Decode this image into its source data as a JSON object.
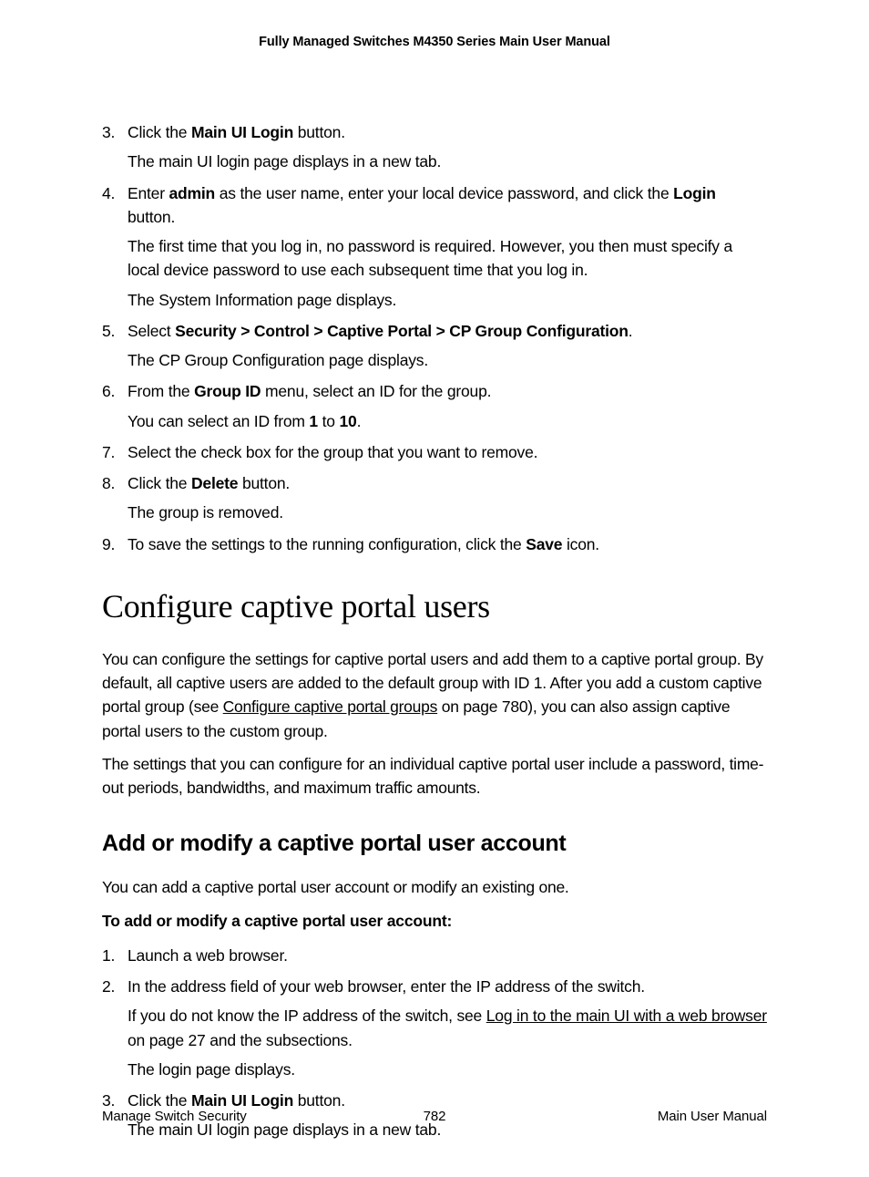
{
  "header": "Fully Managed Switches M4350 Series Main User Manual",
  "steps1": {
    "s3": {
      "a": "Click the ",
      "b": "Main UI Login",
      "c": " button.",
      "p1": "The main UI login page displays in a new tab."
    },
    "s4": {
      "a": "Enter ",
      "b": "admin",
      "c": " as the user name, enter your local device password, and click the ",
      "d": "Login",
      "e": " button.",
      "p1": "The first time that you log in, no password is required. However, you then must specify a local device password to use each subsequent time that you log in.",
      "p2": "The System Information page displays."
    },
    "s5": {
      "a": "Select ",
      "b": "Security > Control > Captive Portal > CP Group Configuration",
      "c": ".",
      "p1": "The CP Group Configuration page displays."
    },
    "s6": {
      "a": "From the ",
      "b": "Group ID",
      "c": " menu, select an ID for the group.",
      "p1a": "You can select an ID from ",
      "p1b": "1",
      "p1c": " to ",
      "p1d": "10",
      "p1e": "."
    },
    "s7": {
      "a": "Select the check box for the group that you want to remove."
    },
    "s8": {
      "a": "Click the ",
      "b": "Delete",
      "c": " button.",
      "p1": "The group is removed."
    },
    "s9": {
      "a": "To save the settings to the running configuration, click the ",
      "b": "Save",
      "c": " icon."
    }
  },
  "section": {
    "title": "Configure captive portal users",
    "p1a": "You can configure the settings for captive portal users and add them to a captive portal group. By default, all captive users are added to the default group with ID 1. After you add a custom captive portal group (see ",
    "p1link": "Configure captive portal groups",
    "p1b": " on page 780), you can also assign captive portal users to the custom group.",
    "p2": "The settings that you can configure for an individual captive portal user include a password, time-out periods, bandwidths, and maximum traffic amounts."
  },
  "subsection": {
    "title": "Add or modify a captive portal user account",
    "intro": "You can add a captive portal user account or modify an existing one.",
    "lead": "To add or modify a captive portal user account:",
    "s1": "Launch a web browser.",
    "s2": {
      "a": "In the address field of your web browser, enter the IP address of the switch.",
      "p1a": "If you do not know the IP address of the switch, see ",
      "p1link": "Log in to the main UI with a web browser",
      "p1b": " on page 27 and the subsections.",
      "p2": "The login page displays."
    },
    "s3": {
      "a": "Click the ",
      "b": "Main UI Login",
      "c": " button.",
      "p1": "The main UI login page displays in a new tab."
    }
  },
  "footer": {
    "left": "Manage Switch Security",
    "center": "782",
    "right": "Main User Manual"
  }
}
